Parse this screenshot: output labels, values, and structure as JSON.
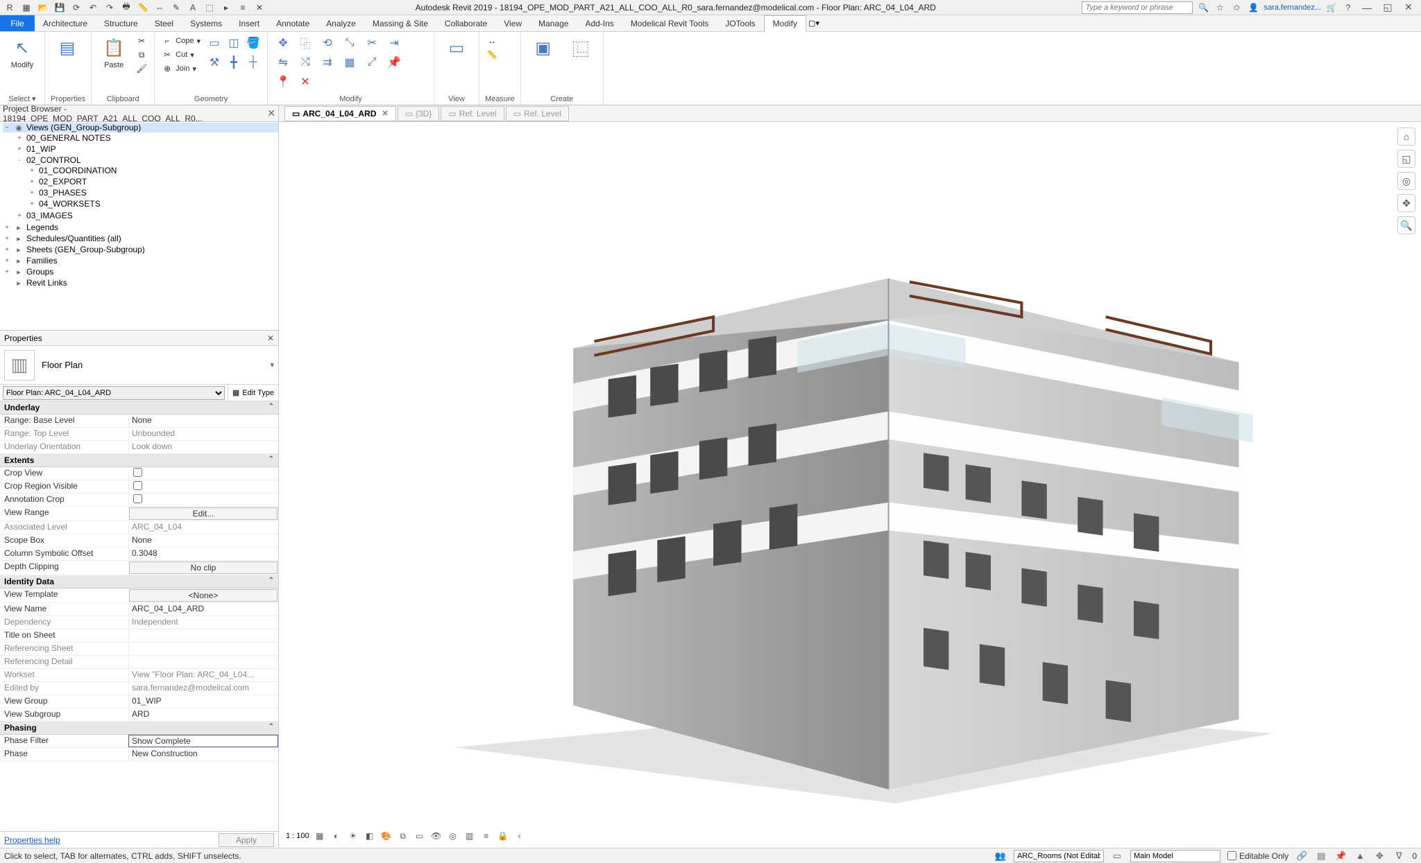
{
  "title": "Autodesk Revit 2019 - 18194_OPE_MOD_PART_A21_ALL_COO_ALL_R0_sara.fernandez@modelical.com - Floor Plan: ARC_04_L04_ARD",
  "search_placeholder": "Type a keyword or phrase",
  "user": "sara.fernandez...",
  "tabs": {
    "file": "File",
    "items": [
      "Architecture",
      "Structure",
      "Steel",
      "Systems",
      "Insert",
      "Annotate",
      "Analyze",
      "Massing & Site",
      "Collaborate",
      "View",
      "Manage",
      "Add-Ins",
      "Modelical Revit Tools",
      "JOTools",
      "Modify"
    ],
    "active": "Modify"
  },
  "ribbon": {
    "select": {
      "modify": "Modify",
      "label": "Select ▾"
    },
    "properties": {
      "btn": "Properties",
      "label": "Properties"
    },
    "clipboard": {
      "paste": "Paste",
      "cope": "Cope",
      "cut": "Cut",
      "join": "Join",
      "label": "Clipboard"
    },
    "geometry": {
      "label": "Geometry"
    },
    "modify": {
      "label": "Modify"
    },
    "view": {
      "label": "View"
    },
    "measure": {
      "label": "Measure"
    },
    "create": {
      "label": "Create"
    }
  },
  "docTabs": {
    "browserTitle": "Project Browser - 18194_OPE_MOD_PART_A21_ALL_COO_ALL_R0...",
    "views": [
      {
        "label": "ARC_04_L04_ARD",
        "active": true
      },
      {
        "label": "{3D}",
        "ghost": true
      },
      {
        "label": "Ref. Level",
        "ghost": true
      },
      {
        "label": "Ref. Level",
        "ghost": true
      }
    ]
  },
  "browser": {
    "root": "Views (GEN_Group-Subgroup)",
    "l1": [
      {
        "t": "00_GENERAL NOTES",
        "exp": "+"
      },
      {
        "t": "01_WIP",
        "exp": "+"
      },
      {
        "t": "02_CONTROL",
        "exp": "-",
        "children": [
          {
            "t": "01_COORDINATION",
            "exp": "+"
          },
          {
            "t": "02_EXPORT",
            "exp": "+"
          },
          {
            "t": "03_PHASES",
            "exp": "+"
          },
          {
            "t": "04_WORKSETS",
            "exp": "+"
          }
        ]
      },
      {
        "t": "03_IMAGES",
        "exp": "+"
      }
    ],
    "top": [
      {
        "t": "Legends",
        "exp": "+"
      },
      {
        "t": "Schedules/Quantities (all)",
        "exp": "+"
      },
      {
        "t": "Sheets (GEN_Group-Subgroup)",
        "exp": "+"
      },
      {
        "t": "Families",
        "exp": "+"
      },
      {
        "t": "Groups",
        "exp": "+"
      },
      {
        "t": "Revit Links"
      }
    ]
  },
  "props": {
    "title": "Properties",
    "type": "Floor Plan",
    "instance": "Floor Plan: ARC_04_L04_ARD",
    "editType": "Edit Type",
    "groups": [
      {
        "name": "Underlay",
        "rows": [
          {
            "n": "Range: Base Level",
            "v": "None"
          },
          {
            "n": "Range: Top Level",
            "v": "Unbounded",
            "ro": true
          },
          {
            "n": "Underlay Orientation",
            "v": "Look down",
            "ro": true
          }
        ]
      },
      {
        "name": "Extents",
        "rows": [
          {
            "n": "Crop View",
            "v": "",
            "cb": true
          },
          {
            "n": "Crop Region Visible",
            "v": "",
            "cb": true
          },
          {
            "n": "Annotation Crop",
            "v": "",
            "cb": true
          },
          {
            "n": "View Range",
            "v": "Edit...",
            "btn": true
          },
          {
            "n": "Associated Level",
            "v": "ARC_04_L04",
            "ro": true
          },
          {
            "n": "Scope Box",
            "v": "None"
          },
          {
            "n": "Column Symbolic Offset",
            "v": "0.3048"
          },
          {
            "n": "Depth Clipping",
            "v": "No clip",
            "btn": true
          }
        ]
      },
      {
        "name": "Identity Data",
        "rows": [
          {
            "n": "View Template",
            "v": "<None>",
            "btn": true
          },
          {
            "n": "View Name",
            "v": "ARC_04_L04_ARD"
          },
          {
            "n": "Dependency",
            "v": "Independent",
            "ro": true
          },
          {
            "n": "Title on Sheet",
            "v": ""
          },
          {
            "n": "Referencing Sheet",
            "v": "",
            "ro": true
          },
          {
            "n": "Referencing Detail",
            "v": "",
            "ro": true
          },
          {
            "n": "Workset",
            "v": "View \"Floor Plan: ARC_04_L04...",
            "ro": true
          },
          {
            "n": "Edited by",
            "v": "sara.fernandez@modelical.com",
            "ro": true
          },
          {
            "n": "View Group",
            "v": "01_WIP"
          },
          {
            "n": "View Subgroup",
            "v": "ARD"
          }
        ]
      },
      {
        "name": "Phasing",
        "rows": [
          {
            "n": "Phase Filter",
            "v": "Show Complete",
            "sel": true
          },
          {
            "n": "Phase",
            "v": "New Construction"
          }
        ]
      }
    ],
    "helpLink": "Properties help",
    "apply": "Apply"
  },
  "vcb": {
    "scale": "1 : 100"
  },
  "status": {
    "hint": "Click to select, TAB for alternates, CTRL adds, SHIFT unselects.",
    "workset": "ARC_Rooms (Not Editable)",
    "model": "Main Model",
    "editable": "Editable Only"
  }
}
